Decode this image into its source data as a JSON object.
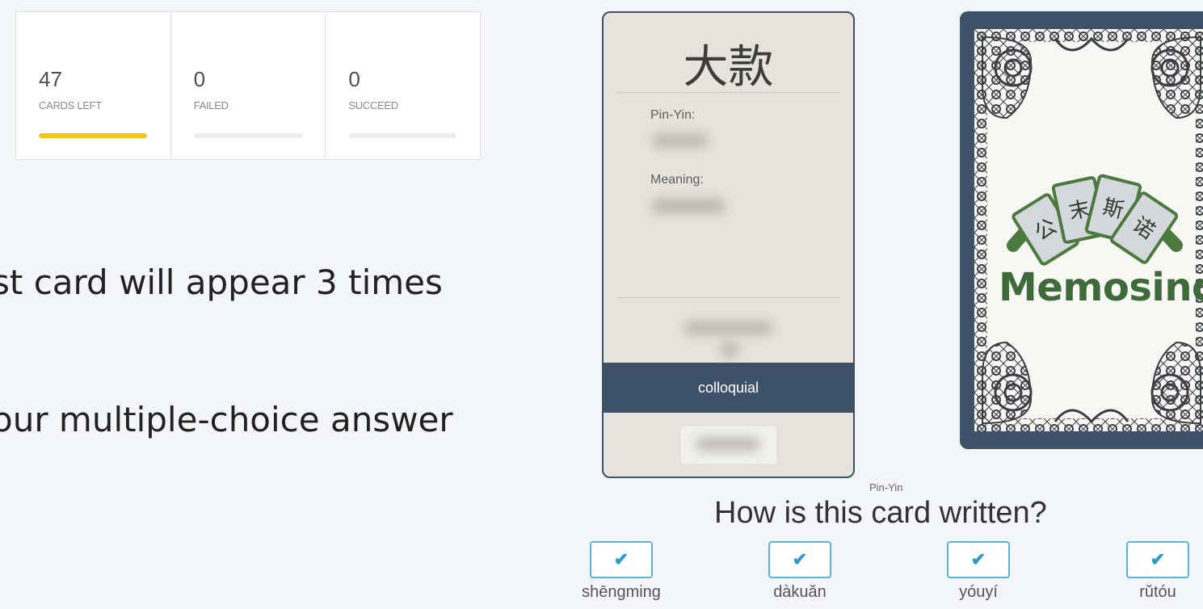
{
  "stats": [
    {
      "value": "47",
      "label": "CARDS LEFT",
      "progress": 1.0
    },
    {
      "value": "0",
      "label": "FAILED",
      "progress": 0
    },
    {
      "value": "0",
      "label": "SUCCEED",
      "progress": 0
    }
  ],
  "instructions": {
    "line1": "st card will appear 3 times",
    "line2": "our multiple-choice answer"
  },
  "card": {
    "hanzi": "大款",
    "pinyin_label": "Pin-Yin:",
    "meaning_label": "Meaning:",
    "register": "colloquial"
  },
  "deck": {
    "logo": "Memosino",
    "tiles": [
      "公",
      "末",
      "斯",
      "诺"
    ]
  },
  "question": {
    "hint": "Pin-Yin",
    "text": "How is this card written?",
    "choices": [
      {
        "label": "shēngming",
        "icon": "check-icon"
      },
      {
        "label": "dàkuǎn",
        "icon": "check-icon"
      },
      {
        "label": "yóuyí",
        "icon": "check-icon"
      },
      {
        "label": "rǔtóu",
        "icon": "check-icon"
      }
    ]
  },
  "colors": {
    "accent": "#f5c312",
    "card_band": "#3d5169",
    "choice_border": "#5ab3da",
    "logo_green": "#3f6b3a"
  }
}
